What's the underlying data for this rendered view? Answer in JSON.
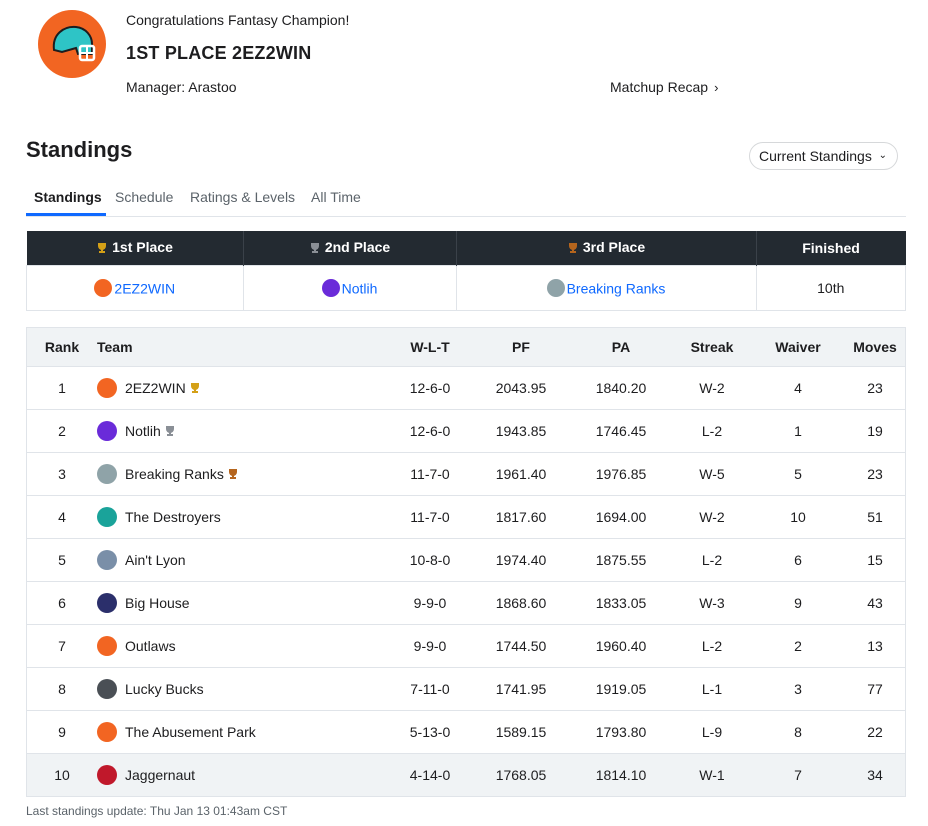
{
  "champion": {
    "congrats": "Congratulations Fantasy Champion!",
    "title": "1ST PLACE 2EZ2WIN",
    "manager": "Manager: Arastoo",
    "recap_label": "Matchup Recap",
    "logo_icon": "helmet-icon",
    "logo_color": "#f26522",
    "helmet_color": "#2ec4c6"
  },
  "section": {
    "title": "Standings",
    "dropdown_value": "Current Standings"
  },
  "tabs": [
    {
      "label": "Standings",
      "active": true
    },
    {
      "label": "Schedule",
      "active": false
    },
    {
      "label": "Ratings & Levels",
      "active": false
    },
    {
      "label": "All Time",
      "active": false
    }
  ],
  "places": {
    "headers": [
      "1st Place",
      "2nd Place",
      "3rd Place",
      "Finished"
    ],
    "values": [
      "2EZ2WIN",
      "Notlih",
      "Breaking Ranks",
      "10th"
    ],
    "trophy_colors": [
      "#d4a017",
      "#8a8f96",
      "#b5651d"
    ]
  },
  "standings": {
    "headers": [
      "Rank",
      "Team",
      "W-L-T",
      "PF",
      "PA",
      "Streak",
      "Waiver",
      "Moves"
    ],
    "rows": [
      {
        "rank": "1",
        "team": "2EZ2WIN",
        "wlt": "12-6-0",
        "pf": "2043.95",
        "pa": "1840.20",
        "streak": "W-2",
        "waiver": "4",
        "moves": "23",
        "trophy": "gold",
        "logo": "#f26522"
      },
      {
        "rank": "2",
        "team": "Notlih",
        "wlt": "12-6-0",
        "pf": "1943.85",
        "pa": "1746.45",
        "streak": "L-2",
        "waiver": "1",
        "moves": "19",
        "trophy": "silver",
        "logo": "#6a2bd9"
      },
      {
        "rank": "3",
        "team": "Breaking Ranks",
        "wlt": "11-7-0",
        "pf": "1961.40",
        "pa": "1976.85",
        "streak": "W-5",
        "waiver": "5",
        "moves": "23",
        "trophy": "bronze",
        "logo": "#8fa3a8"
      },
      {
        "rank": "4",
        "team": "The Destroyers",
        "wlt": "11-7-0",
        "pf": "1817.60",
        "pa": "1694.00",
        "streak": "W-2",
        "waiver": "10",
        "moves": "51",
        "trophy": "",
        "logo": "#1aa39a"
      },
      {
        "rank": "5",
        "team": "Ain't Lyon",
        "wlt": "10-8-0",
        "pf": "1974.40",
        "pa": "1875.55",
        "streak": "L-2",
        "waiver": "6",
        "moves": "15",
        "trophy": "",
        "logo": "#7a8fa8"
      },
      {
        "rank": "6",
        "team": "Big House",
        "wlt": "9-9-0",
        "pf": "1868.60",
        "pa": "1833.05",
        "streak": "W-3",
        "waiver": "9",
        "moves": "43",
        "trophy": "",
        "logo": "#2b2f6b"
      },
      {
        "rank": "7",
        "team": "Outlaws",
        "wlt": "9-9-0",
        "pf": "1744.50",
        "pa": "1960.40",
        "streak": "L-2",
        "waiver": "2",
        "moves": "13",
        "trophy": "",
        "logo": "#f26522"
      },
      {
        "rank": "8",
        "team": "Lucky Bucks",
        "wlt": "7-11-0",
        "pf": "1741.95",
        "pa": "1919.05",
        "streak": "L-1",
        "waiver": "3",
        "moves": "77",
        "trophy": "",
        "logo": "#4a4f55"
      },
      {
        "rank": "9",
        "team": "The Abusement Park",
        "wlt": "5-13-0",
        "pf": "1589.15",
        "pa": "1793.80",
        "streak": "L-9",
        "waiver": "8",
        "moves": "22",
        "trophy": "",
        "logo": "#f26522"
      },
      {
        "rank": "10",
        "team": "Jaggernaut",
        "wlt": "4-14-0",
        "pf": "1768.05",
        "pa": "1814.10",
        "streak": "W-1",
        "waiver": "7",
        "moves": "34",
        "trophy": "",
        "logo": "#c0182b"
      }
    ]
  },
  "footer": "Last standings update: Thu Jan 13 01:43am CST"
}
